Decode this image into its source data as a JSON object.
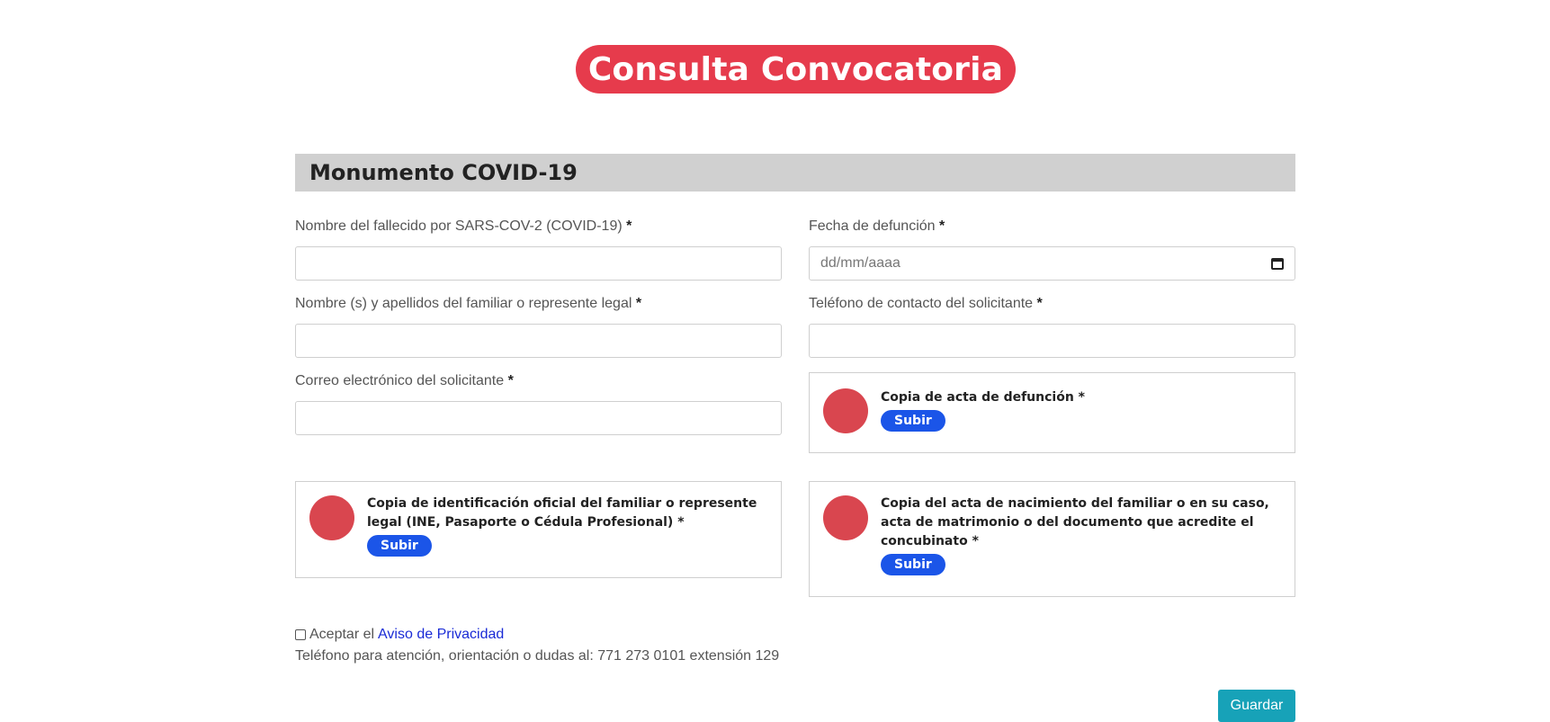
{
  "header": {
    "title": "Consulta Convocatoria"
  },
  "section": {
    "title": "Monumento COVID-19"
  },
  "form": {
    "required_mark": "*",
    "fields": {
      "deceased_name": {
        "label": "Nombre del fallecido por SARS-COV-2 (COVID-19)",
        "value": ""
      },
      "death_date": {
        "label": "Fecha de defunción",
        "placeholder": "dd/mm/aaaa"
      },
      "family_name": {
        "label": "Nombre (s) y apellidos del familiar o represente legal",
        "value": ""
      },
      "contact_phone": {
        "label": "Teléfono de contacto del solicitante",
        "value": ""
      },
      "email": {
        "label": "Correo electrónico del solicitante",
        "value": ""
      }
    },
    "uploads": {
      "death_certificate": {
        "lines": [
          "Copia de acta de defunción *"
        ]
      },
      "id_copy": {
        "lines": [
          "Copia de identificación oficial del familiar o represente",
          "legal (INE, Pasaporte o Cédula Profesional) *"
        ]
      },
      "birth_certificate": {
        "lines": [
          "Copia del acta de nacimiento del familiar o en su caso,",
          "acta de matrimonio o del documento que acredite el",
          "concubinato *"
        ]
      },
      "button_label": "Subir"
    },
    "privacy": {
      "prefix": "Aceptar el",
      "link_text": "Aviso de Privacidad",
      "checked": false
    },
    "help_text": "Teléfono para atención, orientación o dudas al: 771 273 0101 extensión 129",
    "save_label": "Guardar"
  },
  "colors": {
    "title_bg": "#e63b4c",
    "section_bg": "#d0d0d0",
    "upload_circle": "#d9464f",
    "upload_button": "#1b55e8",
    "link": "#1a2bd6",
    "save_button": "#17a2b8"
  }
}
